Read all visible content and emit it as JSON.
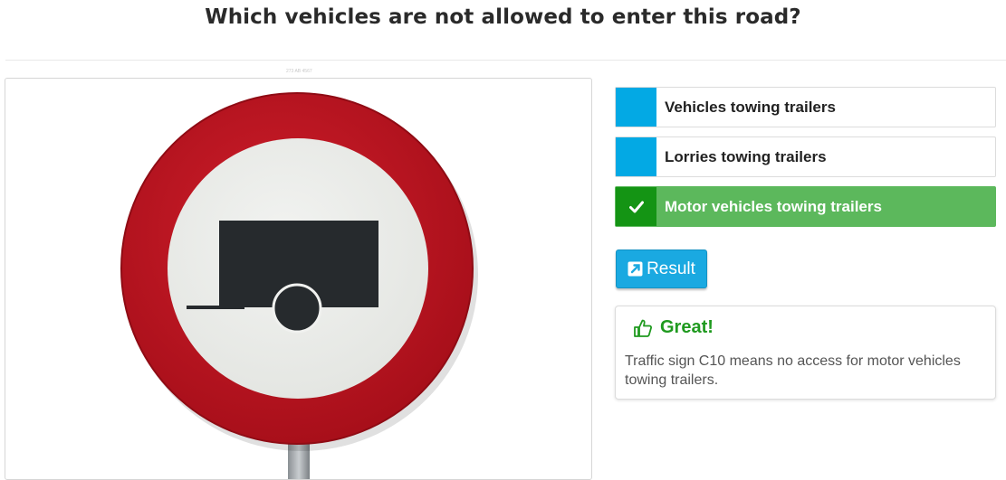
{
  "question": {
    "title": "Which vehicles are not allowed to enter this road?"
  },
  "image": {
    "caption": "273 AB 4567",
    "subject": "traffic-sign-c10-no-motor-vehicles-towing-trailers"
  },
  "answers": [
    {
      "label": "Vehicles towing trailers",
      "state": "neutral"
    },
    {
      "label": "Lorries towing trailers",
      "state": "neutral"
    },
    {
      "label": "Motor vehicles towing trailers",
      "state": "correct",
      "icon": "check-icon"
    }
  ],
  "result_button": {
    "label": "Result",
    "icon": "external-link-icon"
  },
  "feedback": {
    "icon": "thumbs-up-icon",
    "title": "Great!",
    "text": "Traffic sign C10 means no access for motor vehicles towing trailers."
  },
  "colors": {
    "answer_marker": "#03a9e4",
    "correct_bg": "#5cb85c",
    "correct_marker": "#149414",
    "sign_red": "#b5131f",
    "feedback_green": "#1f9a1f"
  }
}
